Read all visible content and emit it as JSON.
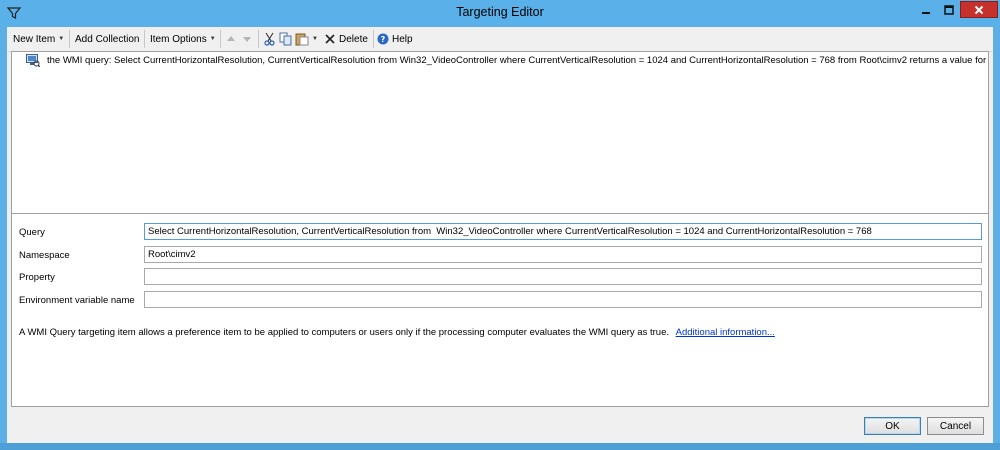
{
  "window": {
    "title": "Targeting Editor"
  },
  "toolbar": {
    "new_item": "New Item",
    "add_collection": "Add Collection",
    "item_options": "Item Options",
    "delete": "Delete",
    "help": "Help"
  },
  "tree": {
    "item_text": "the WMI query: Select CurrentHorizontalResolution, CurrentVerticalResolution from  Win32_VideoController where CurrentVerticalResolution = 1024 and CurrentHorizontalResolution = 768 from Root\\cimv2 returns a value for"
  },
  "properties": {
    "query_label": "Query",
    "query_value": "Select CurrentHorizontalResolution, CurrentVerticalResolution from  Win32_VideoController where CurrentVerticalResolution = 1024 and CurrentHorizontalResolution = 768",
    "namespace_label": "Namespace",
    "namespace_value": "Root\\cimv2",
    "property_label": "Property",
    "property_value": "",
    "env_label": "Environment variable name",
    "env_value": "",
    "description": "A WMI Query targeting item allows a preference item to be applied to computers or users only if the processing computer evaluates the WMI query as true.",
    "more_info_link": "Additional information..."
  },
  "buttons": {
    "ok": "OK",
    "cancel": "Cancel"
  },
  "colors": {
    "title_bar": "#5ab0e8",
    "close_button": "#c7312b",
    "link": "#0033cc"
  }
}
